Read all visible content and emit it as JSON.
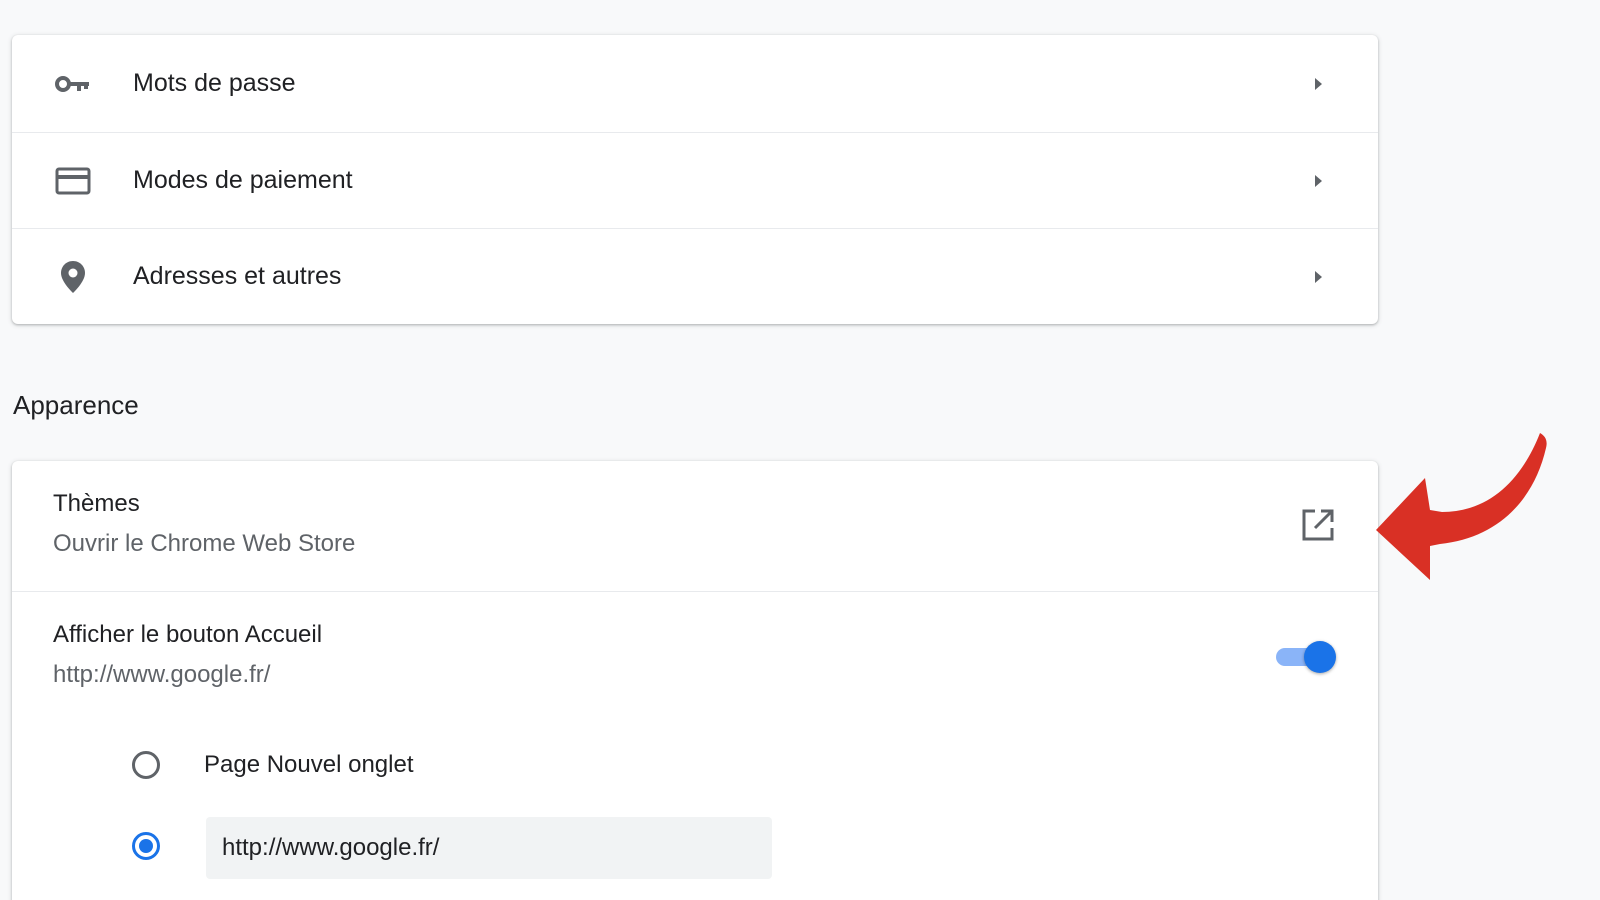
{
  "autofill": {
    "items": [
      {
        "label": "Mots de passe",
        "icon": "key-icon"
      },
      {
        "label": "Modes de paiement",
        "icon": "credit-card-icon"
      },
      {
        "label": "Adresses et autres",
        "icon": "location-pin-icon"
      }
    ]
  },
  "appearance": {
    "section_title": "Apparence",
    "themes": {
      "title": "Thèmes",
      "subtitle": "Ouvrir le Chrome Web Store",
      "icon": "open-in-new-icon"
    },
    "home_button": {
      "title": "Afficher le bouton Accueil",
      "subtitle": "http://www.google.fr/",
      "enabled": true
    },
    "home_options": {
      "new_tab_label": "Page Nouvel onglet",
      "new_tab_selected": false,
      "custom_url_value": "http://www.google.fr/",
      "custom_url_selected": true
    }
  },
  "colors": {
    "accent": "#1a73e8",
    "toggle_track": "#8ab4f8",
    "annotation_arrow": "#d93025"
  }
}
